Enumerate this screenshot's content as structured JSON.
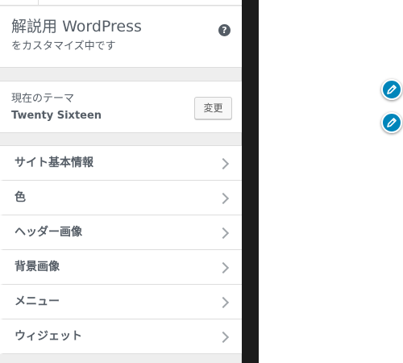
{
  "info": {
    "title_prefix": "解説用",
    "title_brand": "WordPress",
    "subtitle": "をカスタマイズ中です",
    "help_icon": "question-circle-icon"
  },
  "theme": {
    "label": "現在のテーマ",
    "name": "Twenty Sixteen",
    "change_label": "変更"
  },
  "sections": [
    {
      "label": "サイト基本情報"
    },
    {
      "label": "色"
    },
    {
      "label": "ヘッダー画像"
    },
    {
      "label": "背景画像"
    },
    {
      "label": "メニュー"
    },
    {
      "label": "ウィジェット"
    }
  ],
  "preview": {
    "edit_icon": "pencil-icon"
  },
  "colors": {
    "accent": "#0085ba",
    "text": "#555d66",
    "strip": "#1b1b1b"
  }
}
